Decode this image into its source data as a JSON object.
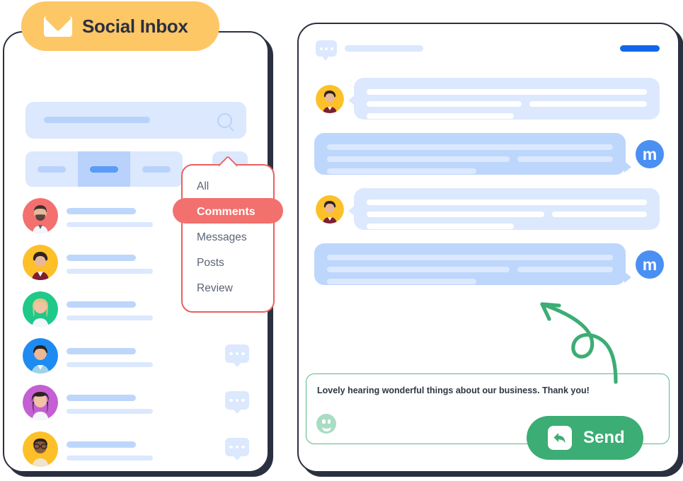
{
  "badge": {
    "label": "Social Inbox",
    "icon": "envelope-icon",
    "bg_color": "#fdc765",
    "text_color": "#2b3040"
  },
  "left_panel": {
    "search": {
      "placeholder_bar": true,
      "icon": "search-icon"
    },
    "segments": [
      {
        "id": "seg-1",
        "active": false
      },
      {
        "id": "seg-2",
        "active": true
      },
      {
        "id": "seg-3",
        "active": false
      }
    ],
    "filter_button": {
      "icon": "funnel-icon",
      "color": "#1267e8"
    },
    "rows": [
      {
        "avatar": "avatar-bearded-man",
        "ring": "#f3706f",
        "has_bubble_icon": false
      },
      {
        "avatar": "avatar-curly-man",
        "ring": "#fdc028",
        "has_bubble_icon": false
      },
      {
        "avatar": "avatar-blonde-woman",
        "ring": "#1ec98a",
        "has_bubble_icon": false
      },
      {
        "avatar": "avatar-smiling-man",
        "ring": "#1e8bf2",
        "has_bubble_icon": true
      },
      {
        "avatar": "avatar-asian-woman",
        "ring": "#c45fd4",
        "has_bubble_icon": true
      },
      {
        "avatar": "avatar-glasses-man",
        "ring": "#fdc028",
        "has_bubble_icon": true
      }
    ]
  },
  "dropdown": {
    "border_color": "#ec5f5f",
    "selected": "Comments",
    "items": [
      {
        "label": "All",
        "selected": false
      },
      {
        "label": "Comments",
        "selected": true
      },
      {
        "label": "Messages",
        "selected": false
      },
      {
        "label": "Posts",
        "selected": false
      },
      {
        "label": "Review",
        "selected": false
      }
    ]
  },
  "right_panel": {
    "header": {
      "icon": "chat-bubble-icon",
      "title_bar": true,
      "action_bar_color": "#1267e8"
    },
    "messages": [
      {
        "direction": "incoming",
        "avatar": "avatar-curly-man",
        "lines": 3
      },
      {
        "direction": "outgoing",
        "avatar": "avatar-brand-m",
        "avatar_letter": "m",
        "lines": 3
      },
      {
        "direction": "incoming",
        "avatar": "avatar-curly-man",
        "lines": 3
      },
      {
        "direction": "outgoing",
        "avatar": "avatar-brand-m",
        "avatar_letter": "m",
        "lines": 3
      }
    ],
    "compose": {
      "text": "Lovely hearing wonderful things about our business. Thank you!",
      "emoji_icon": "smiley-icon",
      "border_color": "#55b988"
    },
    "send_button": {
      "label": "Send",
      "icon": "reply-arrow-icon",
      "bg_color": "#3cad74"
    },
    "annotation": {
      "icon": "curly-arrow-icon",
      "color": "#3cad74"
    }
  }
}
